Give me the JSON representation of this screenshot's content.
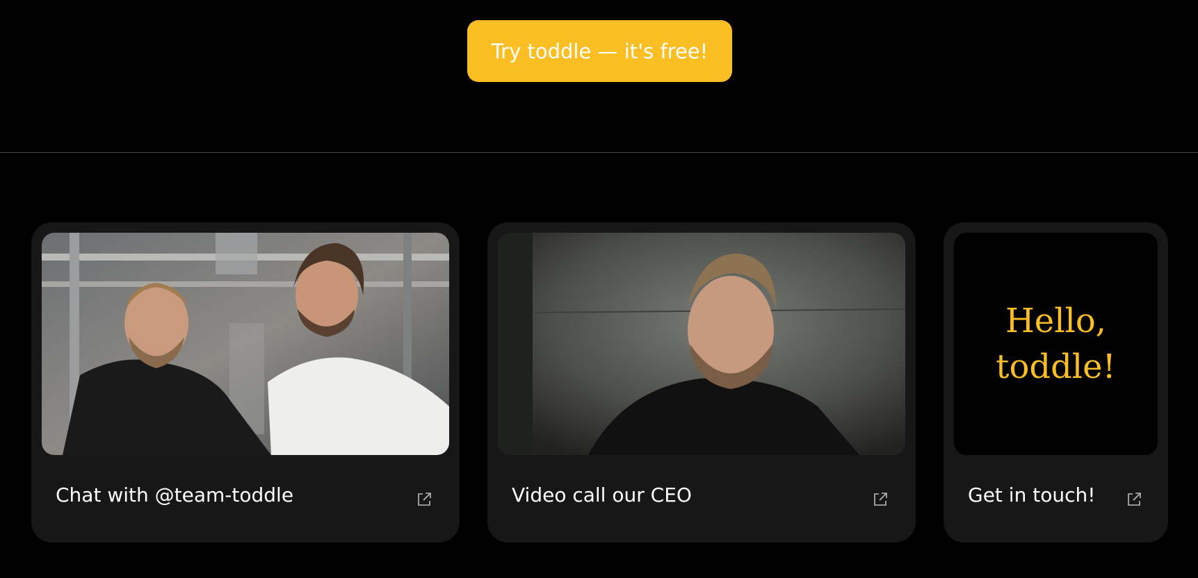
{
  "cta": {
    "label": "Try toddle — it's free!"
  },
  "cards": [
    {
      "label": "Chat with @team-toddle",
      "image": "photo-two-founders",
      "icon": "external-link-icon"
    },
    {
      "label": "Video call our CEO",
      "image": "photo-ceo-portrait",
      "icon": "external-link-icon"
    },
    {
      "label": "Get in touch!",
      "greeting_line1": "Hello,",
      "greeting_line2": "toddle!",
      "icon": "external-link-icon"
    }
  ],
  "colors": {
    "background": "#000000",
    "accent": "#FBBF24",
    "card": "#171717",
    "divider": "#4a4a4a",
    "text": "#ffffff"
  }
}
